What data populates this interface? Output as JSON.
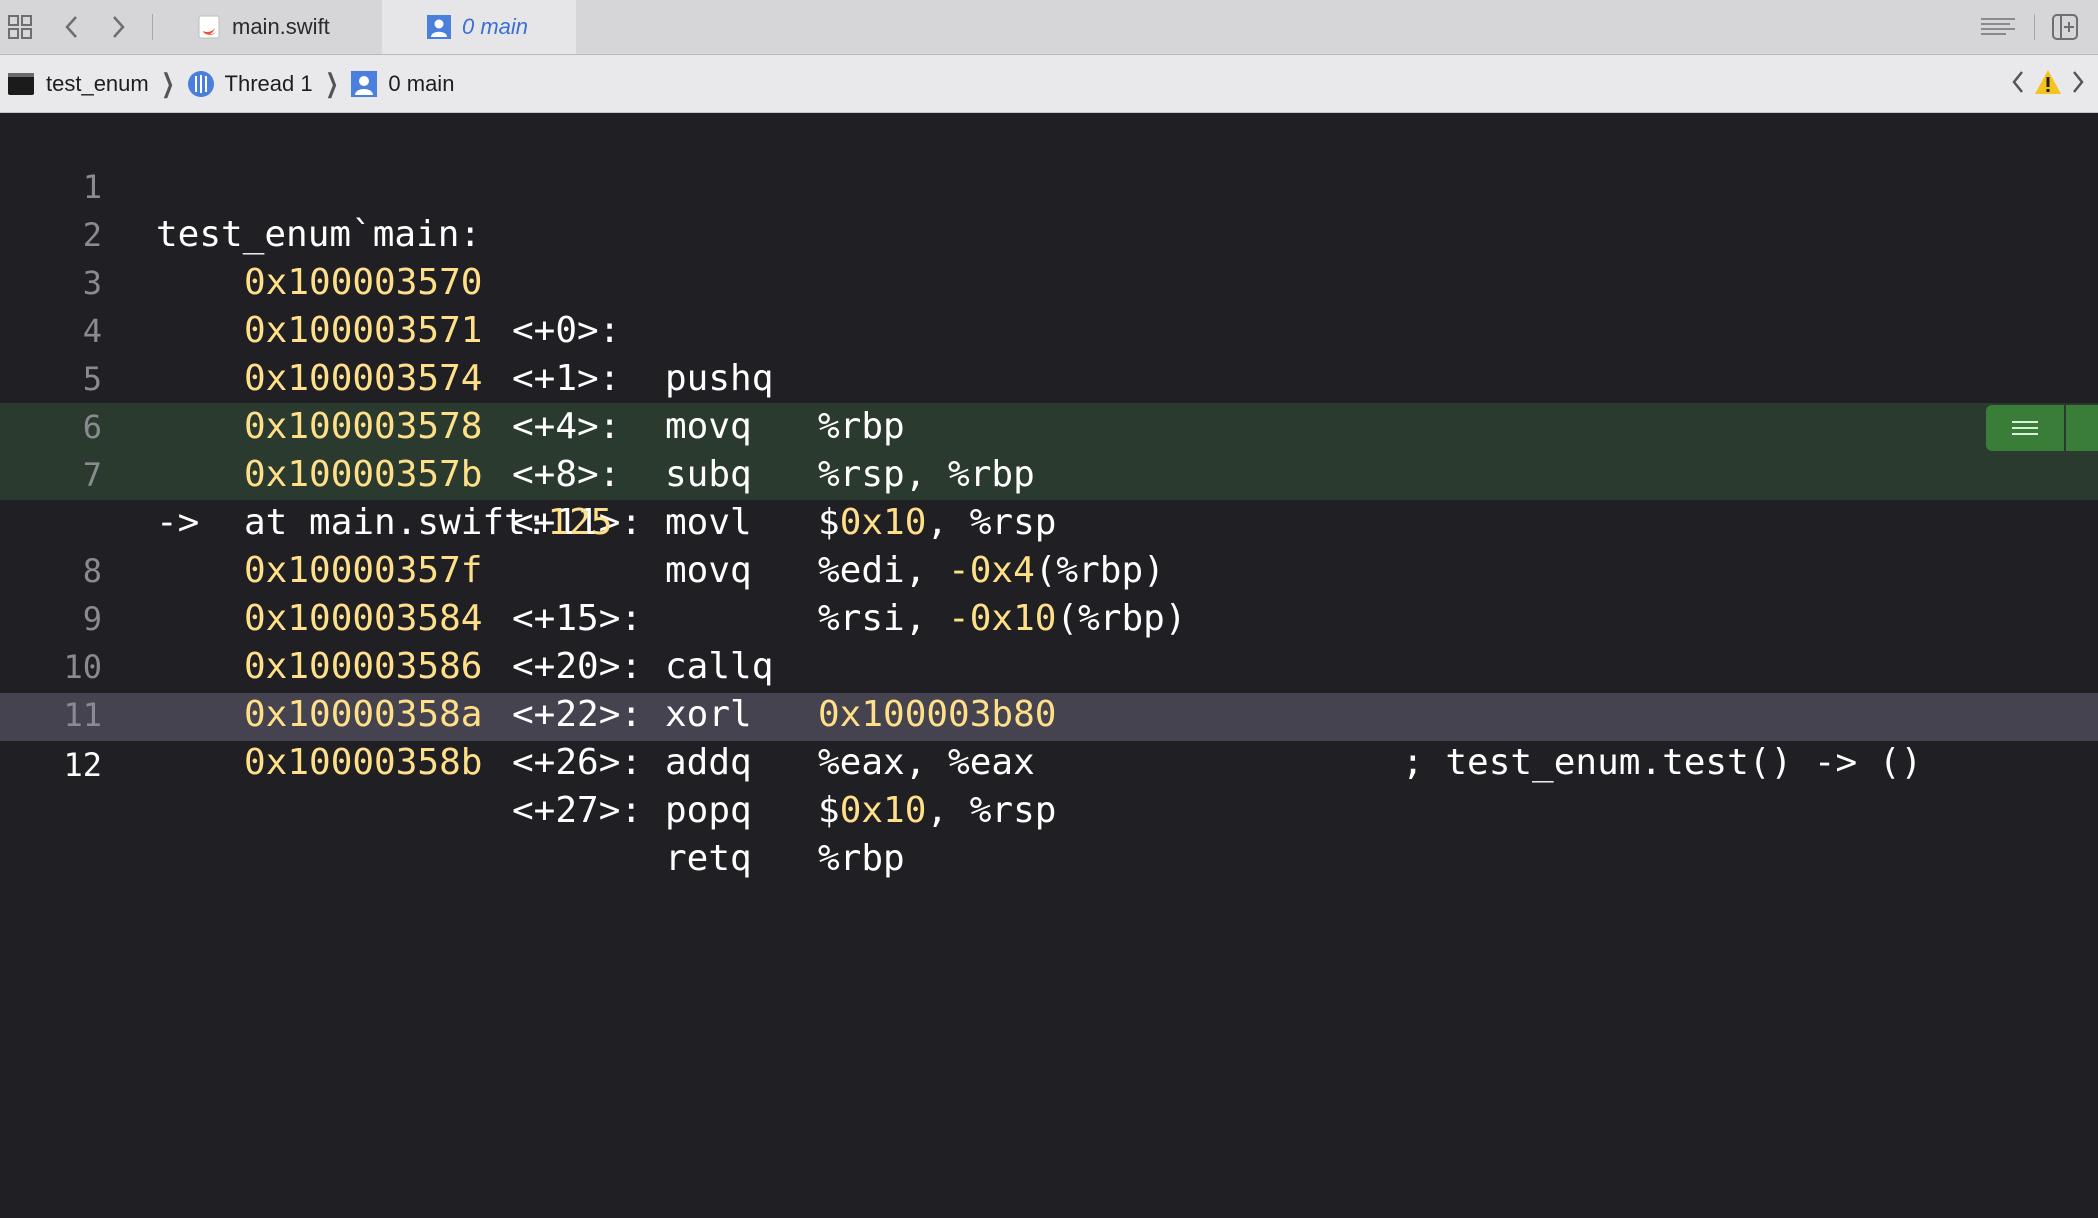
{
  "tabbar": {
    "tabs": [
      {
        "label": "main.swift",
        "icon": "swift-file-icon"
      },
      {
        "label": "0 main",
        "icon": "stack-frame-icon",
        "active": true
      }
    ]
  },
  "jumpbar": {
    "crumbs": [
      {
        "label": "test_enum",
        "icon": "terminal-app-icon"
      },
      {
        "label": "Thread 1",
        "icon": "thread-icon"
      },
      {
        "label": "0 main",
        "icon": "stack-frame-icon"
      }
    ]
  },
  "colors": {
    "accent": "#3a6fd8",
    "number": "#ffe089",
    "highlight": "#2b3a2e",
    "badge": "#3a7d38",
    "warning": "#f5c31b"
  },
  "editor": {
    "lines": [
      {
        "n": "1",
        "text": "test_enum`main:"
      },
      {
        "n": "2",
        "addr": "0x100003570",
        "off": "<+0>:",
        "mnem": "pushq",
        "ops": "%rbp"
      },
      {
        "n": "3",
        "addr": "0x100003571",
        "off": "<+1>:",
        "mnem": "movq",
        "ops": "%rsp, %rbp"
      },
      {
        "n": "4",
        "addr": "0x100003574",
        "off": "<+4>:",
        "mnem": "subq",
        "ops": "$0x10, %rsp"
      },
      {
        "n": "5",
        "addr": "0x100003578",
        "off": "<+8>:",
        "mnem": "movl",
        "ops": "%edi, -0x4(%rbp)"
      },
      {
        "n": "6",
        "addr": "0x10000357b",
        "off": "<+11>:",
        "mnem": "movq",
        "ops": "%rsi, -0x10(%rbp)"
      },
      {
        "n": "7",
        "arrow": "->",
        "addr": "0x10000357f",
        "off": "<+15>:",
        "mnem": "callq",
        "ops": "0x100003b80",
        "comment": "; test_enum.test() -> ()",
        "cont": "at main.swift:125"
      },
      {
        "n": "8",
        "addr": "0x100003584",
        "off": "<+20>:",
        "mnem": "xorl",
        "ops": "%eax, %eax"
      },
      {
        "n": "9",
        "addr": "0x100003586",
        "off": "<+22>:",
        "mnem": "addq",
        "ops": "$0x10, %rsp"
      },
      {
        "n": "10",
        "addr": "0x10000358a",
        "off": "<+26>:",
        "mnem": "popq",
        "ops": "%rbp"
      },
      {
        "n": "11",
        "addr": "0x10000358b",
        "off": "<+27>:",
        "mnem": "retq",
        "ops": ""
      },
      {
        "n": "12"
      }
    ]
  }
}
